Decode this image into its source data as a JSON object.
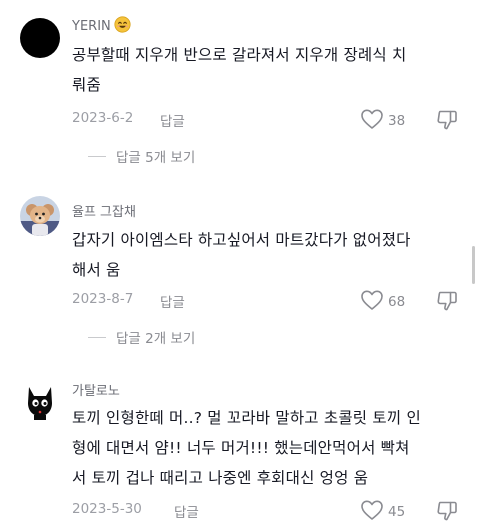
{
  "comments": [
    {
      "username": "YERIN",
      "username_emoji": "smiling-face-emoji",
      "text_lines": [
        "공부할때 지우개 반으로 갈라져서 지우개 장례식 치",
        "뤄줌"
      ],
      "date": "2023-6-2",
      "reply_label": "답글",
      "likes": "38",
      "view_replies": "답글 5개 보기",
      "avatar": "black-circle"
    },
    {
      "username": "율프 그잡채",
      "text_lines": [
        "갑자기 아이엠스타 하고싶어서 마트갔다가 없어졌다",
        "해서 움"
      ],
      "date": "2023-8-7",
      "reply_label": "답글",
      "likes": "68",
      "view_replies": "답글 2개 보기",
      "avatar": "dog-photo"
    },
    {
      "username": "가탈로노",
      "text_lines": [
        "토끼 인형한떼 머..? 멀 꼬라바 말하고 초콜릿 토끼 인",
        "형에 대면서 얌!! 너두 머거!!! 했는데안먹어서 빡쳐",
        "서 토끼 겁나 때리고 나중엔 후회대신 엉엉 움"
      ],
      "date": "2023-5-30",
      "reply_label": "답글",
      "likes": "45",
      "avatar": "black-cat-drawing"
    }
  ],
  "icons": {
    "like": "heart-outline-icon",
    "dislike": "thumbs-down-outline-icon"
  }
}
